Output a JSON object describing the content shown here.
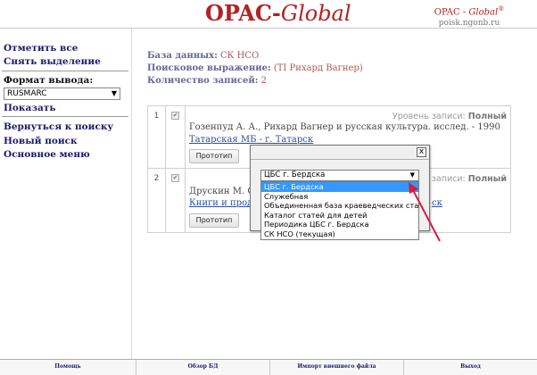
{
  "header": {
    "brand_main": "OPAC-",
    "brand_italic": "Global",
    "brand_right_main": "OPAC - ",
    "brand_right_italic": "Global",
    "brand_right_reg": "®",
    "brand_right_site": "poisk.ngonb.ru"
  },
  "sidebar": {
    "select_all": "Отметить все",
    "deselect": "Снять выделение",
    "format_label": "Формат вывода:",
    "format_value": "RUSMARC",
    "show": "Показать",
    "back_to_search": "Вернуться к поиску",
    "new_search": "Новый поиск",
    "main_menu": "Основное меню"
  },
  "info": {
    "db_label": "База данных:",
    "db_value": "СК НСО",
    "query_label": "Поисковое выражение:",
    "query_value": "(TI Рихард Вагнер)",
    "count_label": "Количество записей:",
    "count_value": "2"
  },
  "records": [
    {
      "num": "1",
      "check": "✔",
      "level_label": "Уровень записи:",
      "level_value": "Полный",
      "text": "Гозенпуд А. А., Рихард Вагнер и русская культура. исслед. - 1990",
      "link": "Татарская МБ - г. Татарск",
      "button": "Прототип"
    },
    {
      "num": "2",
      "check": "✔",
      "level_label": "Уровень записи:",
      "level_value": "Полный",
      "text": "Друскин М. С.",
      "link": "Книги и продо",
      "link_tail": "ск",
      "button": "Прототип"
    }
  ],
  "popup": {
    "close": "x",
    "selected": "ЦБС г. Бердска",
    "options": [
      "ЦБС г. Бердска",
      "Служебная",
      "Объединенная база краеведческих статей",
      "Каталог статей для детей",
      "Периодика ЦБС г. Бердска",
      "СК НСО (текущая)"
    ]
  },
  "footer": {
    "help": "Помощь",
    "db_overview": "Обзор БД",
    "import": "Импорт внешнего файла",
    "exit": "Выход"
  },
  "colors": {
    "brand": "#b22222",
    "selection": "#3399ff",
    "arrow": "#d81b3f",
    "link": "#2a4da0"
  },
  "icons": {
    "dropdown": "chevron-down-icon",
    "close": "close-icon",
    "annotation": "red-arrow-icon"
  }
}
